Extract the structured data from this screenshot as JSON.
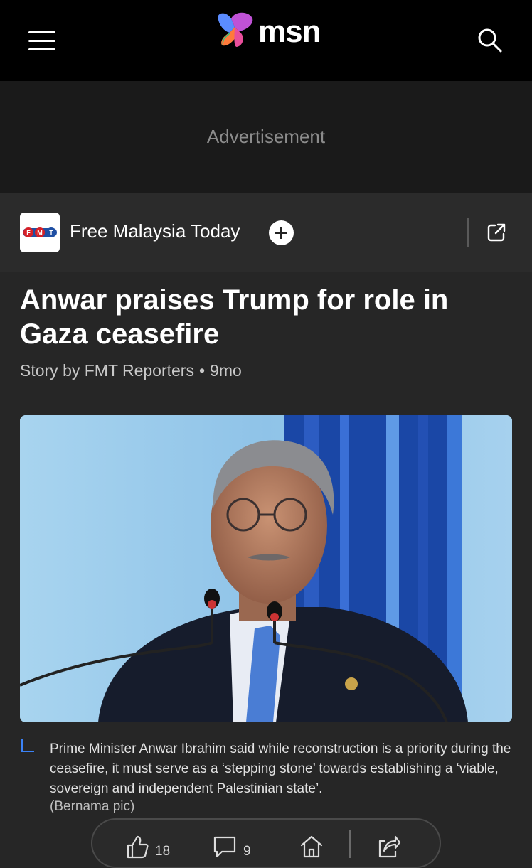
{
  "header": {
    "brand_name": "msn",
    "menu_icon": "hamburger-menu-icon",
    "search_icon": "search-icon"
  },
  "ad": {
    "label": "Advertisement"
  },
  "publisher": {
    "name": "Free Malaysia Today",
    "logo_text": "FMT",
    "follow_icon": "plus-circle-icon",
    "external_icon": "open-external-icon"
  },
  "article": {
    "title": "Anwar praises Trump for role in Gaza ceasefire",
    "author": "Story by FMT Reporters",
    "separator": "•",
    "age": "9mo",
    "image_caption": "Prime Minister Anwar Ibrahim said while reconstruction is a priority during the ceasefire, it must serve as a ‘stepping stone’ towards establishing a ‘viable, sovereign and independent Palestinian state’.",
    "image_credit": "(Bernama pic)"
  },
  "actions": {
    "like_count": "18",
    "comment_count": "9",
    "like_icon": "thumbs-up-icon",
    "comment_icon": "comment-icon",
    "home_icon": "home-icon",
    "share_icon": "share-icon"
  },
  "colors": {
    "topbar_bg": "#000000",
    "page_bg": "#262626",
    "caption_accent": "#3b82f6",
    "fmt_red": "#d62027",
    "fmt_blue": "#1f4fa3"
  }
}
